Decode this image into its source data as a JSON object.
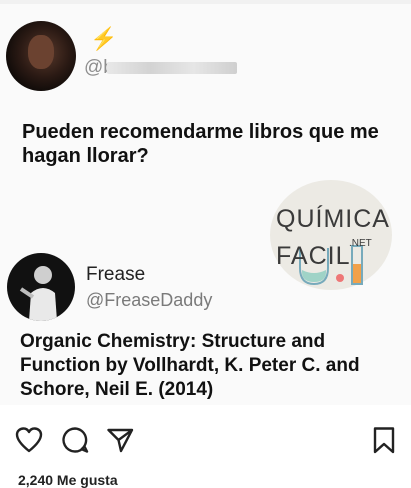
{
  "post": {
    "author1": {
      "icon": "lightning-icon",
      "handle_prefix": "@b"
    },
    "tweet1_text": "Pueden recomendarme libros que me hagan llorar?",
    "watermark": {
      "line1": "QUÍMICA",
      "line2": "FACIL",
      "suffix": ".NET"
    },
    "author2": {
      "name": "Frease",
      "handle": "@FreaseDaddy"
    },
    "tweet2_text": "Organic Chemistry: Structure and Function by Vollhardt, K. Peter C. and Schore, Neil E. (2014)"
  },
  "actions": {
    "icons": [
      "heart-icon",
      "comment-icon",
      "share-icon",
      "bookmark-icon"
    ]
  },
  "footer": {
    "likes_partial": "2,240 Me gusta"
  }
}
